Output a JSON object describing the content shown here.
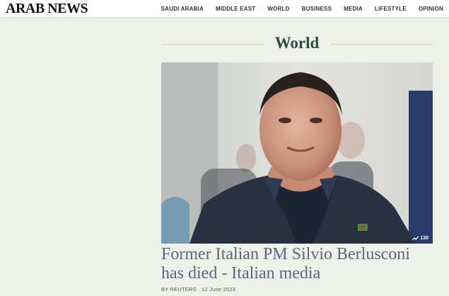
{
  "header": {
    "logo": "ARAB NEWS",
    "nav": [
      "SAUDI ARABIA",
      "MIDDLE EAST",
      "WORLD",
      "BUSINESS",
      "MEDIA",
      "LIFESTYLE",
      "OPINION"
    ]
  },
  "section": {
    "title": "World"
  },
  "article": {
    "image_alt": "Silvio Berlusconi portrait",
    "gallery_count": "130",
    "headline": "Former Italian PM Silvio Berlusconi has died - Italian media",
    "byline_author": "BY REUTERS",
    "byline_date": "12 June 2023"
  },
  "colors": {
    "page_bg": "#eef0ea",
    "section_title": "#2d4a45",
    "headline": "#59687a"
  }
}
